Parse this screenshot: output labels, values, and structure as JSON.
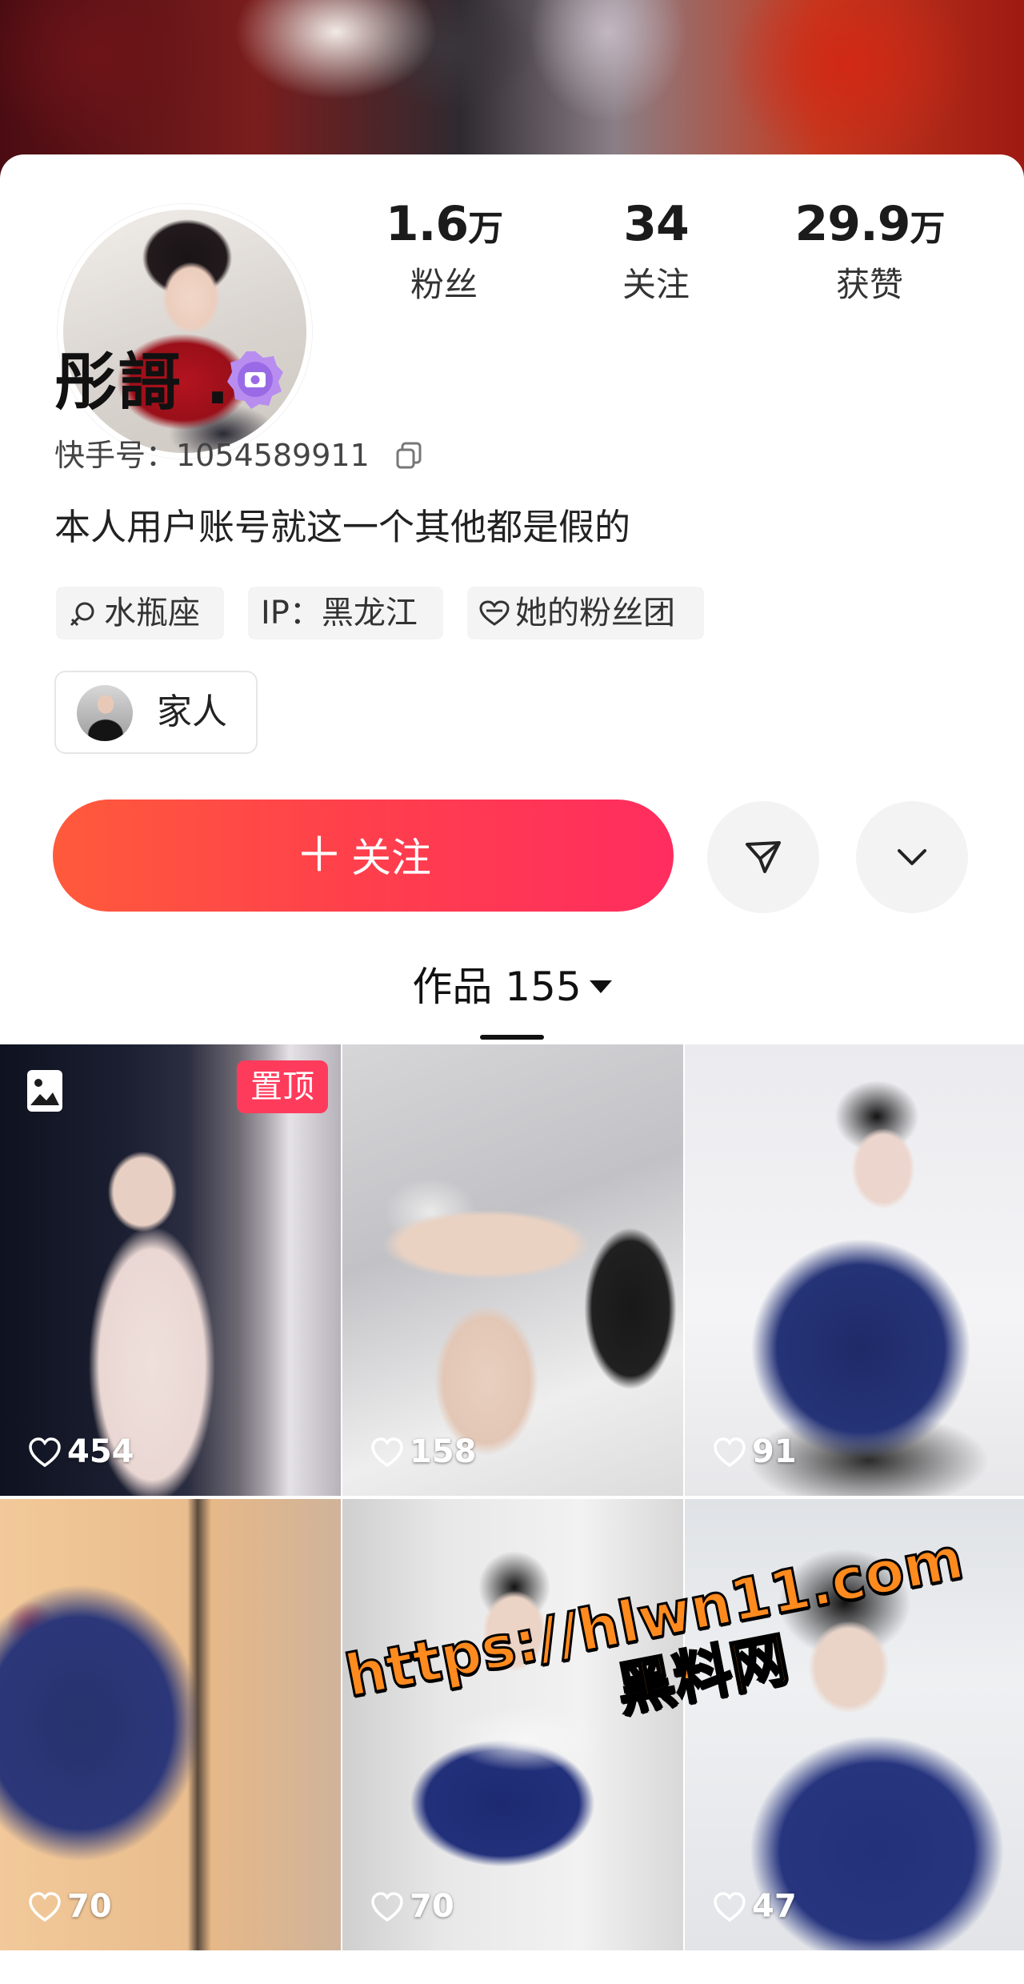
{
  "profile": {
    "stats": [
      {
        "num": "1.6",
        "unit": "万",
        "label": "粉丝"
      },
      {
        "num": "34",
        "unit": "",
        "label": "关注"
      },
      {
        "num": "29.9",
        "unit": "万",
        "label": "获赞"
      }
    ],
    "name": "彤謌 .",
    "id_label": "快手号：1054589911",
    "bio": "本人用户账号就这一个其他都是假的",
    "tags": [
      {
        "icon": "zodiac-icon",
        "label": "水瓶座"
      },
      {
        "icon": "",
        "label": "IP：黑龙江"
      },
      {
        "icon": "fan-group-heart-icon",
        "label": "她的粉丝团"
      }
    ],
    "family_label": "家人",
    "follow_label": "关注",
    "follow_plus": "＋"
  },
  "tabs": {
    "works_label": "作品 155"
  },
  "grid": {
    "pinned_label": "置顶",
    "items": [
      {
        "likes": "454"
      },
      {
        "likes": "158"
      },
      {
        "likes": "91"
      },
      {
        "likes": "70"
      },
      {
        "likes": "70"
      },
      {
        "likes": "47"
      }
    ]
  },
  "watermark": {
    "line1": "https://hlwn11.com",
    "line2": "黑料网"
  },
  "colors": {
    "follow_gradient_start": "#ff5a3c",
    "follow_gradient_end": "#ff2d5f",
    "pinned_badge": "#ff3b5c",
    "watermark": "#ff8a1e"
  }
}
